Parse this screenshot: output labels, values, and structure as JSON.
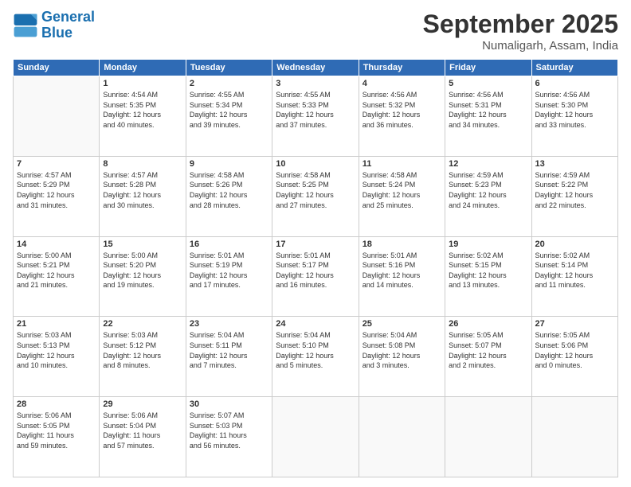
{
  "header": {
    "logo_general": "General",
    "logo_blue": "Blue",
    "month": "September 2025",
    "location": "Numaligarh, Assam, India"
  },
  "weekdays": [
    "Sunday",
    "Monday",
    "Tuesday",
    "Wednesday",
    "Thursday",
    "Friday",
    "Saturday"
  ],
  "weeks": [
    [
      {
        "day": "",
        "content": ""
      },
      {
        "day": "1",
        "content": "Sunrise: 4:54 AM\nSunset: 5:35 PM\nDaylight: 12 hours\nand 40 minutes."
      },
      {
        "day": "2",
        "content": "Sunrise: 4:55 AM\nSunset: 5:34 PM\nDaylight: 12 hours\nand 39 minutes."
      },
      {
        "day": "3",
        "content": "Sunrise: 4:55 AM\nSunset: 5:33 PM\nDaylight: 12 hours\nand 37 minutes."
      },
      {
        "day": "4",
        "content": "Sunrise: 4:56 AM\nSunset: 5:32 PM\nDaylight: 12 hours\nand 36 minutes."
      },
      {
        "day": "5",
        "content": "Sunrise: 4:56 AM\nSunset: 5:31 PM\nDaylight: 12 hours\nand 34 minutes."
      },
      {
        "day": "6",
        "content": "Sunrise: 4:56 AM\nSunset: 5:30 PM\nDaylight: 12 hours\nand 33 minutes."
      }
    ],
    [
      {
        "day": "7",
        "content": "Sunrise: 4:57 AM\nSunset: 5:29 PM\nDaylight: 12 hours\nand 31 minutes."
      },
      {
        "day": "8",
        "content": "Sunrise: 4:57 AM\nSunset: 5:28 PM\nDaylight: 12 hours\nand 30 minutes."
      },
      {
        "day": "9",
        "content": "Sunrise: 4:58 AM\nSunset: 5:26 PM\nDaylight: 12 hours\nand 28 minutes."
      },
      {
        "day": "10",
        "content": "Sunrise: 4:58 AM\nSunset: 5:25 PM\nDaylight: 12 hours\nand 27 minutes."
      },
      {
        "day": "11",
        "content": "Sunrise: 4:58 AM\nSunset: 5:24 PM\nDaylight: 12 hours\nand 25 minutes."
      },
      {
        "day": "12",
        "content": "Sunrise: 4:59 AM\nSunset: 5:23 PM\nDaylight: 12 hours\nand 24 minutes."
      },
      {
        "day": "13",
        "content": "Sunrise: 4:59 AM\nSunset: 5:22 PM\nDaylight: 12 hours\nand 22 minutes."
      }
    ],
    [
      {
        "day": "14",
        "content": "Sunrise: 5:00 AM\nSunset: 5:21 PM\nDaylight: 12 hours\nand 21 minutes."
      },
      {
        "day": "15",
        "content": "Sunrise: 5:00 AM\nSunset: 5:20 PM\nDaylight: 12 hours\nand 19 minutes."
      },
      {
        "day": "16",
        "content": "Sunrise: 5:01 AM\nSunset: 5:19 PM\nDaylight: 12 hours\nand 17 minutes."
      },
      {
        "day": "17",
        "content": "Sunrise: 5:01 AM\nSunset: 5:17 PM\nDaylight: 12 hours\nand 16 minutes."
      },
      {
        "day": "18",
        "content": "Sunrise: 5:01 AM\nSunset: 5:16 PM\nDaylight: 12 hours\nand 14 minutes."
      },
      {
        "day": "19",
        "content": "Sunrise: 5:02 AM\nSunset: 5:15 PM\nDaylight: 12 hours\nand 13 minutes."
      },
      {
        "day": "20",
        "content": "Sunrise: 5:02 AM\nSunset: 5:14 PM\nDaylight: 12 hours\nand 11 minutes."
      }
    ],
    [
      {
        "day": "21",
        "content": "Sunrise: 5:03 AM\nSunset: 5:13 PM\nDaylight: 12 hours\nand 10 minutes."
      },
      {
        "day": "22",
        "content": "Sunrise: 5:03 AM\nSunset: 5:12 PM\nDaylight: 12 hours\nand 8 minutes."
      },
      {
        "day": "23",
        "content": "Sunrise: 5:04 AM\nSunset: 5:11 PM\nDaylight: 12 hours\nand 7 minutes."
      },
      {
        "day": "24",
        "content": "Sunrise: 5:04 AM\nSunset: 5:10 PM\nDaylight: 12 hours\nand 5 minutes."
      },
      {
        "day": "25",
        "content": "Sunrise: 5:04 AM\nSunset: 5:08 PM\nDaylight: 12 hours\nand 3 minutes."
      },
      {
        "day": "26",
        "content": "Sunrise: 5:05 AM\nSunset: 5:07 PM\nDaylight: 12 hours\nand 2 minutes."
      },
      {
        "day": "27",
        "content": "Sunrise: 5:05 AM\nSunset: 5:06 PM\nDaylight: 12 hours\nand 0 minutes."
      }
    ],
    [
      {
        "day": "28",
        "content": "Sunrise: 5:06 AM\nSunset: 5:05 PM\nDaylight: 11 hours\nand 59 minutes."
      },
      {
        "day": "29",
        "content": "Sunrise: 5:06 AM\nSunset: 5:04 PM\nDaylight: 11 hours\nand 57 minutes."
      },
      {
        "day": "30",
        "content": "Sunrise: 5:07 AM\nSunset: 5:03 PM\nDaylight: 11 hours\nand 56 minutes."
      },
      {
        "day": "",
        "content": ""
      },
      {
        "day": "",
        "content": ""
      },
      {
        "day": "",
        "content": ""
      },
      {
        "day": "",
        "content": ""
      }
    ]
  ]
}
